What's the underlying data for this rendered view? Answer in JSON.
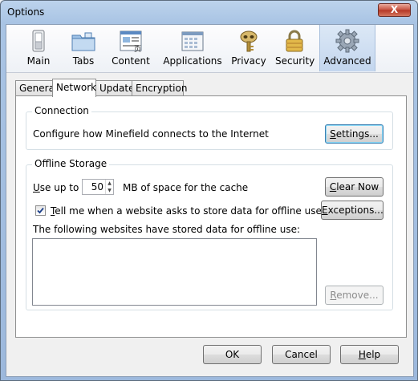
{
  "window": {
    "title": "Options",
    "close_glyph": "X"
  },
  "toolbar": {
    "panes": [
      {
        "label": "Main",
        "icon": "switch-icon"
      },
      {
        "label": "Tabs",
        "icon": "folder-tabs-icon"
      },
      {
        "label": "Content",
        "icon": "content-page-icon"
      },
      {
        "label": "Applications",
        "icon": "applications-window-icon"
      },
      {
        "label": "Privacy",
        "icon": "privacy-key-mask-icon"
      },
      {
        "label": "Security",
        "icon": "padlock-icon"
      },
      {
        "label": "Advanced",
        "icon": "gear-icon"
      }
    ],
    "selected": "Advanced"
  },
  "tabs": {
    "items": [
      "General",
      "Network",
      "Update",
      "Encryption"
    ],
    "selected": "Network"
  },
  "connection": {
    "caption": "Connection",
    "description": "Configure how Minefield connects to the Internet",
    "settings_button": {
      "label": "Settings...",
      "accel": "S",
      "rest": "ettings..."
    }
  },
  "offline": {
    "caption": "Offline Storage",
    "use_up_to": {
      "accel": "U",
      "rest": "se up to"
    },
    "cache_size": "50",
    "cache_unit": "MB of space for the cache",
    "clear_now": {
      "label": "Clear Now",
      "accel": "C",
      "rest": "lear Now"
    },
    "tell_me": {
      "accel": "T",
      "rest": "ell me when a website asks to store data for offline use",
      "checked": true
    },
    "exceptions": {
      "label": "Exceptions...",
      "accel": "E",
      "rest": "xceptions..."
    },
    "list_caption": "The following websites have stored data for offline use:",
    "sites": [],
    "remove": {
      "label": "Remove...",
      "accel": "R",
      "rest": "emove...",
      "enabled": false
    }
  },
  "footer": {
    "ok": "OK",
    "cancel": "Cancel",
    "help": {
      "accel": "H",
      "rest": "elp"
    }
  }
}
